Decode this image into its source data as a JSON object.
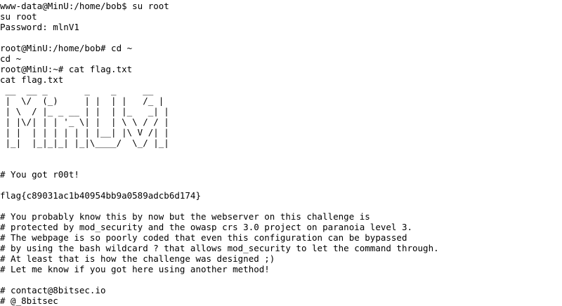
{
  "terminal": {
    "lines": [
      "www-data@MinU:/home/bob$ su root",
      "su root",
      "Password: mlnV1",
      "",
      "root@MinU:/home/bob# cd ~",
      "cd ~",
      "root@MinU:~# cat flag.txt",
      "cat flag.txt",
      " __  __ _       _    _     __ ",
      " |  \\/  (_)     | |  | |   /_ |",
      " | \\  / |_ _ __ | |  | |_   _| |",
      " | |\\/| | | '_ \\| |  | \\ \\ / / |",
      " | |  | | | | | | |__| |\\ V /| |",
      " |_|  |_|_|_| |_|\\____/  \\_/ |_|",
      "",
      "",
      "# You got r00t!",
      "",
      "flag{c89031ac1b40954bb9a0589adcb6d174}",
      "",
      "# You probably know this by now but the webserver on this challenge is",
      "# protected by mod_security and the owasp crs 3.0 project on paranoia level 3.",
      "# The webpage is so poorly coded that even this configuration can be bypassed",
      "# by using the bash wildcard ? that allows mod_security to let the command through.",
      "# At least that is how the challenge was designed ;)",
      "# Let me know if you got here using another method!",
      "",
      "# contact@8bitsec.io",
      "# @_8bitsec"
    ]
  },
  "colors": {
    "background": "#ffffff",
    "text": "#000000"
  }
}
